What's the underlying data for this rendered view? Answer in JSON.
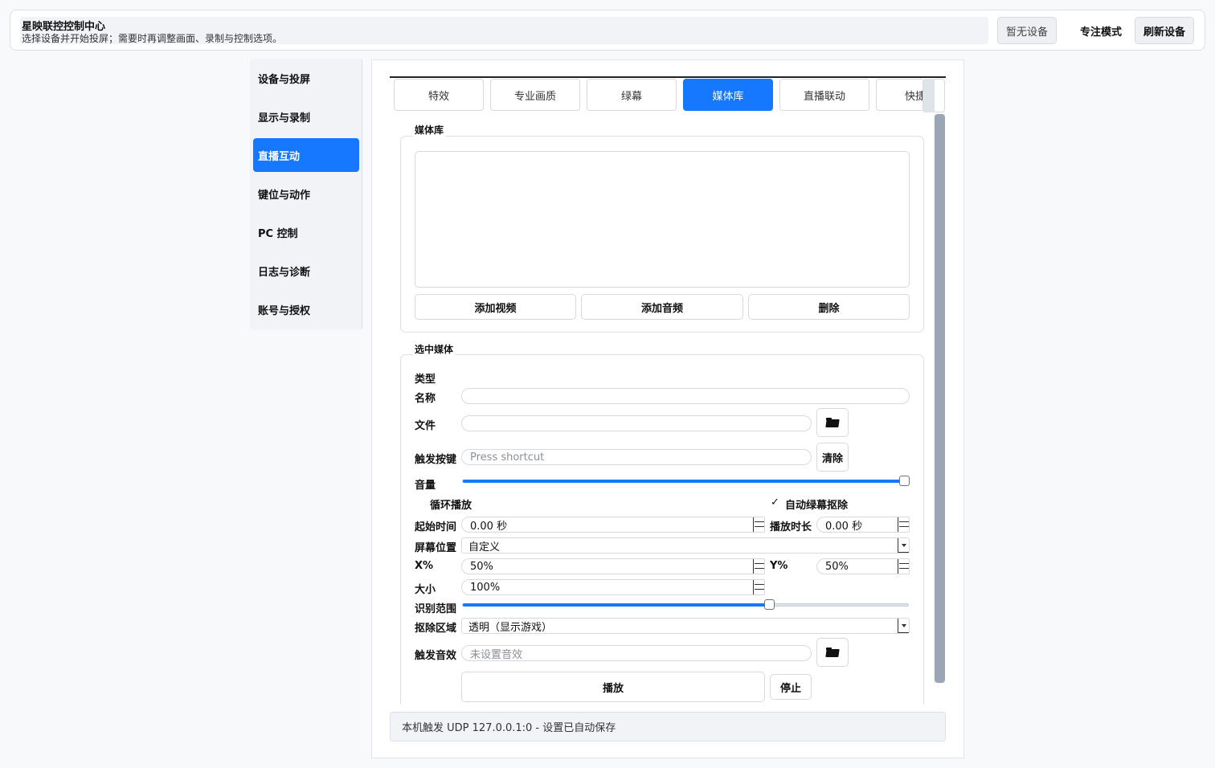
{
  "header": {
    "title": "星映联控控制中心",
    "subtitle": "选择设备并开始投屏；需要时再调整画面、录制与控制选项。",
    "device_button": "暂无设备",
    "focus_button": "专注模式",
    "refresh_button": "刷新设备"
  },
  "sidebar": {
    "items": [
      {
        "label": "设备与投屏"
      },
      {
        "label": "显示与录制"
      },
      {
        "label": "直播互动"
      },
      {
        "label": "键位与动作"
      },
      {
        "label": "PC 控制"
      },
      {
        "label": "日志与诊断"
      },
      {
        "label": "账号与授权"
      }
    ],
    "active_index": 2
  },
  "tabs": {
    "items": [
      {
        "label": "特效"
      },
      {
        "label": "专业画质"
      },
      {
        "label": "绿幕"
      },
      {
        "label": "媒体库"
      },
      {
        "label": "直播联动"
      },
      {
        "label": "快捷"
      }
    ],
    "active_index": 3
  },
  "media_library": {
    "title": "媒体库",
    "add_video": "添加视频",
    "add_audio": "添加音频",
    "delete": "删除"
  },
  "selected_media": {
    "title": "选中媒体",
    "type_label": "类型",
    "name_label": "名称",
    "name_value": "",
    "file_label": "文件",
    "file_value": "",
    "hotkey_label": "触发按键",
    "hotkey_placeholder": "Press shortcut",
    "clear_button": "清除",
    "volume_label": "音量",
    "volume_fraction": 1.0,
    "loop_label": "循环播放",
    "loop_checked": false,
    "auto_chroma_label": "自动绿幕抠除",
    "auto_chroma_checked": true,
    "check_mark": "✓",
    "start_time_label": "起始时间",
    "start_time_value": "0.00 秒",
    "duration_label": "播放时长",
    "duration_value": "0.00 秒",
    "position_label": "屏幕位置",
    "position_value": "自定义",
    "x_label": "X%",
    "x_value": "50%",
    "y_label": "Y%",
    "y_value": "50%",
    "size_label": "大小",
    "size_value": "100%",
    "range_label": "识别范围",
    "range_fraction": 0.69,
    "keyout_label": "抠除区域",
    "keyout_value": "透明（显示游戏）",
    "sound_label": "触发音效",
    "sound_placeholder": "未设置音效",
    "play_button": "播放",
    "stop_button": "停止"
  },
  "status": {
    "text": "本机触发 UDP 127.0.0.1:0 - 设置已自动保存"
  },
  "colors": {
    "accent": "#1677ff",
    "scrollbar": "#9aa6b6"
  }
}
